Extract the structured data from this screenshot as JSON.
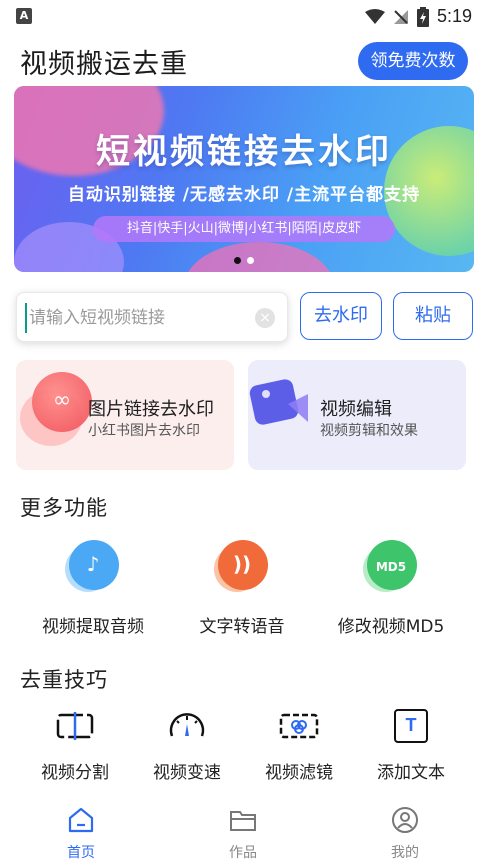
{
  "status_bar": {
    "badge": "A",
    "time": "5:19"
  },
  "header": {
    "title": "视频搬运去重",
    "free_button": "领免费次数"
  },
  "banner": {
    "title": "短视频链接去水印",
    "subtitle": "自动识别链接 /无感去水印 /主流平台都支持",
    "platforms": "抖音|快手|火山|微博|小红书|陌陌|皮皮虾",
    "slide_count": 2,
    "active_slide": 1
  },
  "link_input": {
    "placeholder": "请输入短视频链接",
    "value": ""
  },
  "actions": {
    "remove_watermark": "去水印",
    "paste": "粘贴"
  },
  "feature_cards": [
    {
      "title": "图片链接去水印",
      "subtitle": "小红书图片去水印",
      "icon": "link-icon",
      "color": "#f04a52"
    },
    {
      "title": "视频编辑",
      "subtitle": "视频剪辑和效果",
      "icon": "video-edit-icon",
      "color": "#6b5cf0"
    }
  ],
  "more_section": {
    "title": "更多功能",
    "items": [
      {
        "label": "视频提取音频",
        "icon": "music-note-icon",
        "color": "#4aa8f5"
      },
      {
        "label": "文字转语音",
        "icon": "sound-wave-icon",
        "color": "#f06a3a"
      },
      {
        "label": "修改视频MD5",
        "icon": "md5-icon",
        "color": "#3ec46a",
        "glyph": "MD5"
      }
    ]
  },
  "tips_section": {
    "title": "去重技巧",
    "items": [
      {
        "label": "视频分割",
        "icon": "split-icon"
      },
      {
        "label": "视频变速",
        "icon": "speedometer-icon"
      },
      {
        "label": "视频滤镜",
        "icon": "filter-icon"
      },
      {
        "label": "添加文本",
        "icon": "text-icon",
        "glyph": "T"
      }
    ]
  },
  "bottom_nav": [
    {
      "label": "首页",
      "icon": "home-icon",
      "active": true
    },
    {
      "label": "作品",
      "icon": "folder-icon",
      "active": false
    },
    {
      "label": "我的",
      "icon": "profile-icon",
      "active": false
    }
  ],
  "colors": {
    "accent": "#2f6bf0",
    "teal_cursor": "#0a9b8c"
  }
}
